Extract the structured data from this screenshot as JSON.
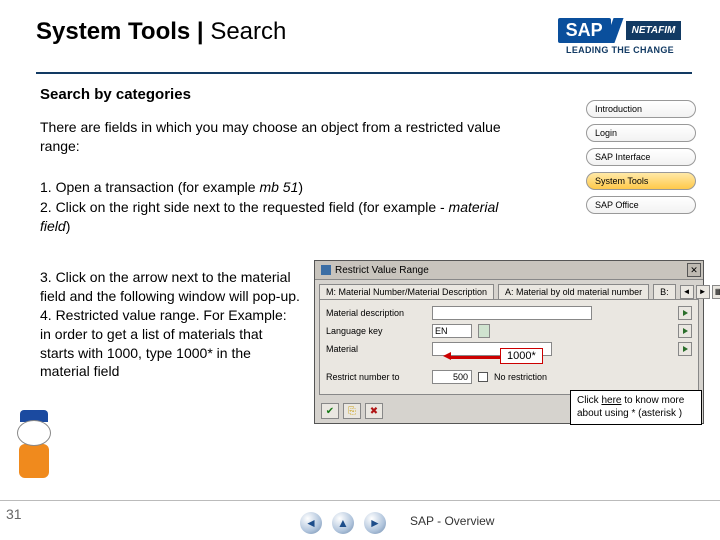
{
  "header": {
    "title_strong": "System Tools",
    "title_sep": " | ",
    "title_light": "Search"
  },
  "logo": {
    "sap": "SAP",
    "netafim": "NETAFIM",
    "tagline": "LEADING THE CHANGE"
  },
  "subheading": "Search by categories",
  "body1": "There are fields in which you may choose an object from a restricted value range:",
  "steps12": {
    "l1a": "1. Open a transaction (for example ",
    "l1em": "mb 51",
    "l1b": ")",
    "l2a": "2. Click on the right side next to the requested field (for example - ",
    "l2em": "material field",
    "l2b": ")"
  },
  "steps34": "3. Click on the arrow next to the material field and the following window will pop-up.\n4. Restricted value range. For Example: in order to get a list of materials that starts with 1000, type 1000* in the material field",
  "nav": {
    "items": [
      "Introduction",
      "Login",
      "SAP Interface",
      "System Tools",
      "SAP Office"
    ],
    "active_index": 3
  },
  "sap_window": {
    "title": "Restrict Value Range",
    "tab1": "M: Material Number/Material Description",
    "tab2": "A: Material by old material number",
    "tab3": "B:",
    "rows": {
      "r1": "Material description",
      "r2": "Language key",
      "r2_value": "EN",
      "r3": "Material",
      "r4": "Restrict number to",
      "r4_value": "500",
      "r4_check": "No restriction"
    }
  },
  "callout_1000": "1000*",
  "callout_tip": {
    "a": "Click ",
    "link": "here",
    "b": " to know more about using * (asterisk )"
  },
  "page_num": "31",
  "footer_text": "SAP - Overview"
}
